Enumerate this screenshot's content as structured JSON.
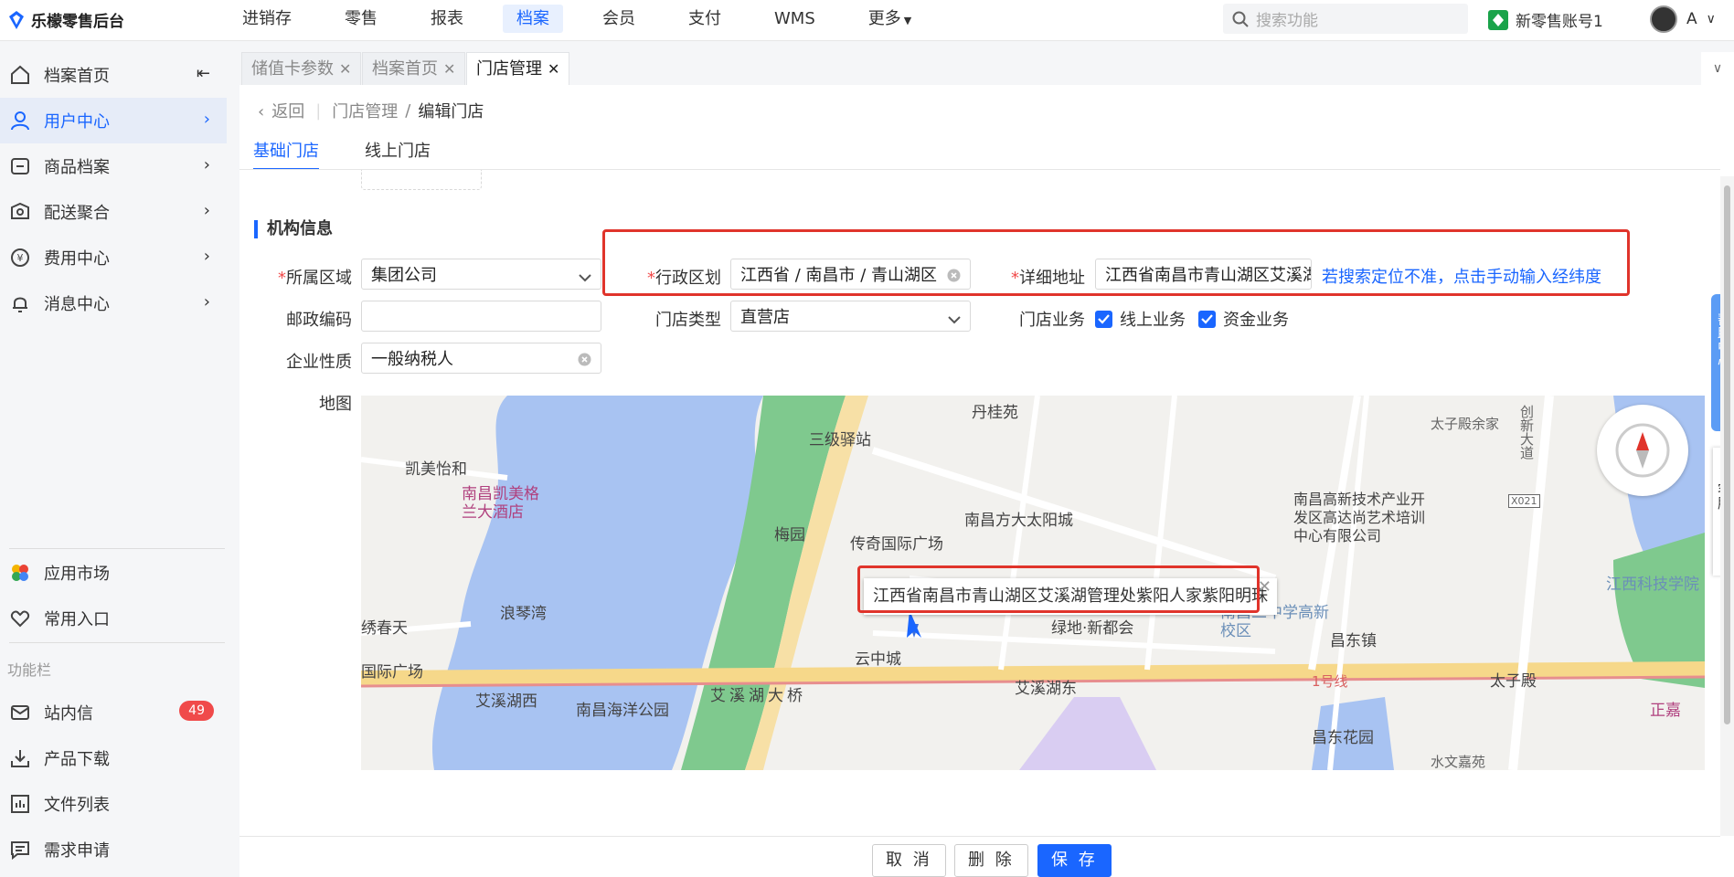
{
  "app": {
    "title": "乐檬零售后台"
  },
  "nav": [
    {
      "label": "进销存",
      "active": false
    },
    {
      "label": "零售",
      "active": false
    },
    {
      "label": "报表",
      "active": false
    },
    {
      "label": "档案",
      "active": true
    },
    {
      "label": "会员",
      "active": false
    },
    {
      "label": "支付",
      "active": false
    },
    {
      "label": "WMS",
      "active": false
    },
    {
      "label": "更多",
      "active": false
    }
  ],
  "search": {
    "placeholder": "搜索功能"
  },
  "account": {
    "name": "新零售账号1"
  },
  "user": {
    "name": "A"
  },
  "sidebar": {
    "items": [
      {
        "label": "档案首页"
      },
      {
        "label": "用户中心"
      },
      {
        "label": "商品档案"
      },
      {
        "label": "配送聚合"
      },
      {
        "label": "费用中心"
      },
      {
        "label": "消息中心"
      }
    ],
    "bottom_items": [
      {
        "label": "应用市场"
      },
      {
        "label": "常用入口"
      }
    ],
    "section_label": "功能栏",
    "func_items": [
      {
        "label": "站内信",
        "badge": "49"
      },
      {
        "label": "产品下载"
      },
      {
        "label": "文件列表"
      },
      {
        "label": "需求申请"
      }
    ]
  },
  "tabs": [
    {
      "label": "储值卡参数",
      "active": false
    },
    {
      "label": "档案首页",
      "active": false
    },
    {
      "label": "门店管理",
      "active": true
    }
  ],
  "breadcrumb": {
    "back": "返回",
    "parent": "门店管理",
    "current": "编辑门店"
  },
  "subtabs": [
    {
      "label": "基础门店",
      "active": true
    },
    {
      "label": "线上门店",
      "active": false
    }
  ],
  "form": {
    "section_title": "机构信息",
    "region": {
      "label": "所属区域",
      "value": "集团公司"
    },
    "admin_region": {
      "label": "行政区划",
      "value": "江西省 / 南昌市 / 青山湖区"
    },
    "address": {
      "label": "详细地址",
      "value": "江西省南昌市青山湖区艾溪湖管理处紫阳人家紫阳明珠"
    },
    "manual_link": "若搜索定位不准，点击手动输入经纬度",
    "postcode": {
      "label": "邮政编码",
      "value": ""
    },
    "store_type": {
      "label": "门店类型",
      "value": "直营店"
    },
    "business": {
      "label": "门店业务",
      "options": [
        "线上业务",
        "资金业务"
      ]
    },
    "company_type": {
      "label": "企业性质",
      "value": "一般纳税人"
    },
    "map_label": "地图"
  },
  "map": {
    "popup": "江西省南昌市青山湖区艾溪湖管理处紫阳人家紫阳明珠",
    "places": [
      "丹桂苑",
      "三级驿站",
      "太子殿余家",
      "凯美怡和",
      "南昌凯美格兰大酒店",
      "梅园",
      "南昌方大太阳城",
      "传奇国际广场",
      "南昌高新技术产业开发区高达尚艺术培训中心有限公司",
      "江西科技学院",
      "浪琴湾",
      "绣春天",
      "国际广场",
      "绿地·新都会",
      "南昌二中学高新校区",
      "昌东镇",
      "云中城",
      "艾溪湖西",
      "南昌海洋公园",
      "艾溪湖大桥",
      "艾溪湖东",
      "1号线",
      "太子殿",
      "正嘉",
      "昌东花园",
      "创新大道",
      "X021",
      "水文嘉苑"
    ]
  },
  "footer": {
    "cancel": "取 消",
    "delete": "删 除",
    "save": "保 存"
  },
  "right_panel": {
    "help": "帮助中心",
    "service": "客服"
  },
  "colors": {
    "primary": "#1a66ff",
    "danger": "#e0342b"
  }
}
